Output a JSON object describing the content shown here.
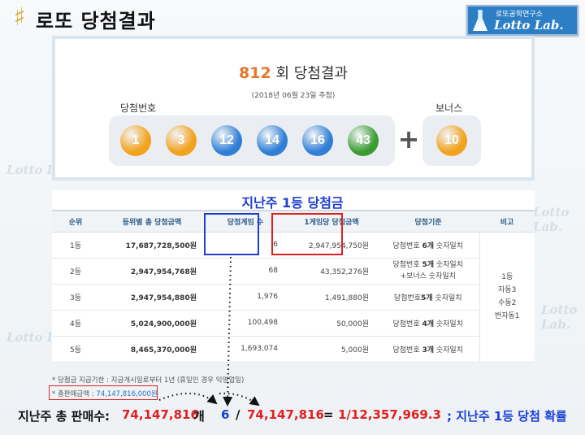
{
  "header": {
    "title": "로또 당첨결과",
    "logo_glyph": "♯",
    "brand_small": "로또공학연구소",
    "brand_main": "Lotto Lab."
  },
  "watermark": {
    "text": "Lotto Lab."
  },
  "result": {
    "round": "812",
    "round_suffix": "회 당첨결과",
    "draw_date": "(2018년 06월 23일 추첨)",
    "winning_label": "당첨번호",
    "bonus_label": "보너스",
    "plus": "+",
    "balls": [
      {
        "n": "1",
        "color": "#f2a21b"
      },
      {
        "n": "3",
        "color": "#f2a21b"
      },
      {
        "n": "12",
        "color": "#2f7fd6"
      },
      {
        "n": "14",
        "color": "#2f7fd6"
      },
      {
        "n": "16",
        "color": "#2f7fd6"
      },
      {
        "n": "43",
        "color": "#3b9b2f"
      }
    ],
    "bonus": {
      "n": "10",
      "color": "#f2a21b"
    }
  },
  "table": {
    "title": "지난주 1등 당첨금",
    "headers": [
      "순위",
      "등위별 총 당첨금액",
      "당첨게임 수",
      "1게임당 당첨금액",
      "당첨기준",
      "비고"
    ],
    "rows": [
      {
        "rank": "1등",
        "total": "17,687,728,500원",
        "games": "6",
        "per": "2,947,954,750원",
        "crit_a": "당첨번호 ",
        "crit_b": "6개",
        "crit_c": " 숫자일치",
        "crit2": ""
      },
      {
        "rank": "2등",
        "total": "2,947,954,768원",
        "games": "68",
        "per": "43,352,276원",
        "crit_a": "당첨번호 ",
        "crit_b": "5개",
        "crit_c": " 숫자일치",
        "crit2": "+보너스 숫자일치"
      },
      {
        "rank": "3등",
        "total": "2,947,954,880원",
        "games": "1,976",
        "per": "1,491,880원",
        "crit_a": "당첨번호",
        "crit_b": "5개",
        "crit_c": " 숫자일치",
        "crit2": ""
      },
      {
        "rank": "4등",
        "total": "5,024,900,000원",
        "games": "100,498",
        "per": "50,000원",
        "crit_a": "당첨번호 ",
        "crit_b": "4개",
        "crit_c": " 숫자일치",
        "crit2": ""
      },
      {
        "rank": "5등",
        "total": "8,465,370,000원",
        "games": "1,693,074",
        "per": "5,000원",
        "crit_a": "당첨번호 ",
        "crit_b": "3개",
        "crit_c": " 숫자일치",
        "crit2": ""
      }
    ],
    "note_lines": [
      "1등",
      "자동3",
      "수동2",
      "반자동1"
    ]
  },
  "footnotes": {
    "claim": "* 당첨금 지급기한 : 지급개시일로부터 1년 (휴일인 경우 익영업일)",
    "sales_label": "* 총판매금액 : ",
    "sales_value": "74,147,816,000원"
  },
  "formula": {
    "label": "지난주 총 판매수:",
    "sales": "74,147,816",
    "unit": "개",
    "winners": "6",
    "slash": "/",
    "sales2": "74,147,816",
    "eq": "=",
    "odds": "1/12,357,969.3",
    "tail": "; 지난주 1등 당첨 확률"
  }
}
